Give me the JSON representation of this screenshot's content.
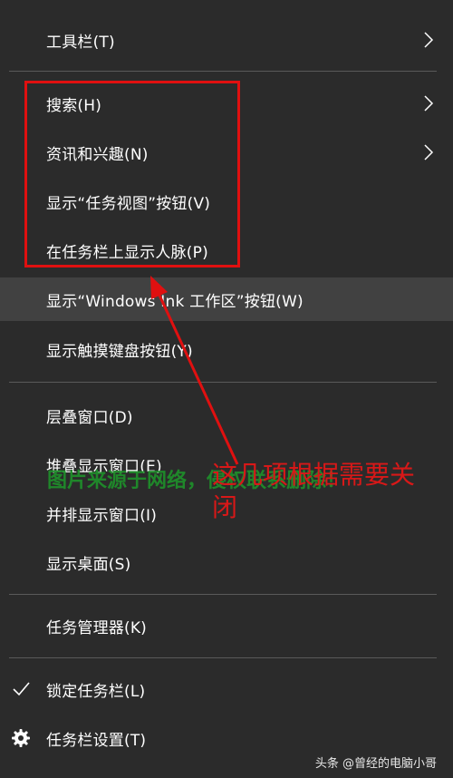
{
  "menu": {
    "toolbars": "工具栏(T)",
    "search": "搜索(H)",
    "news_interests": "资讯和兴趣(N)",
    "show_task_view": "显示“任务视图”按钮(V)",
    "show_people": "在任务栏上显示人脉(P)",
    "show_ink_workspace": "显示“Windows Ink 工作区”按钮(W)",
    "show_touch_keyboard": "显示触摸键盘按钮(Y)",
    "cascade": "层叠窗口(D)",
    "stacked": "堆叠显示窗口(E)",
    "side_by_side": "并排显示窗口(I)",
    "show_desktop": "显示桌面(S)",
    "task_manager": "任务管理器(K)",
    "lock_taskbar": "锁定任务栏(L)",
    "taskbar_settings": "任务栏设置(T)"
  },
  "overlay": {
    "watermark": "图片来源于网络，侵权联系删除！",
    "annotation": "这几项根据需要关闭",
    "credit": "头条 @曾经的电脑小哥"
  },
  "colors": {
    "menu_bg": "#2b2b2b",
    "hover_bg": "#414141",
    "separator": "#5a5a5a",
    "annotation_red": "#e01010",
    "watermark_green": "#1e8f2a"
  },
  "icons": {
    "submenu": "chevron-right-icon",
    "lock_check": "check-icon",
    "settings": "gear-icon"
  }
}
